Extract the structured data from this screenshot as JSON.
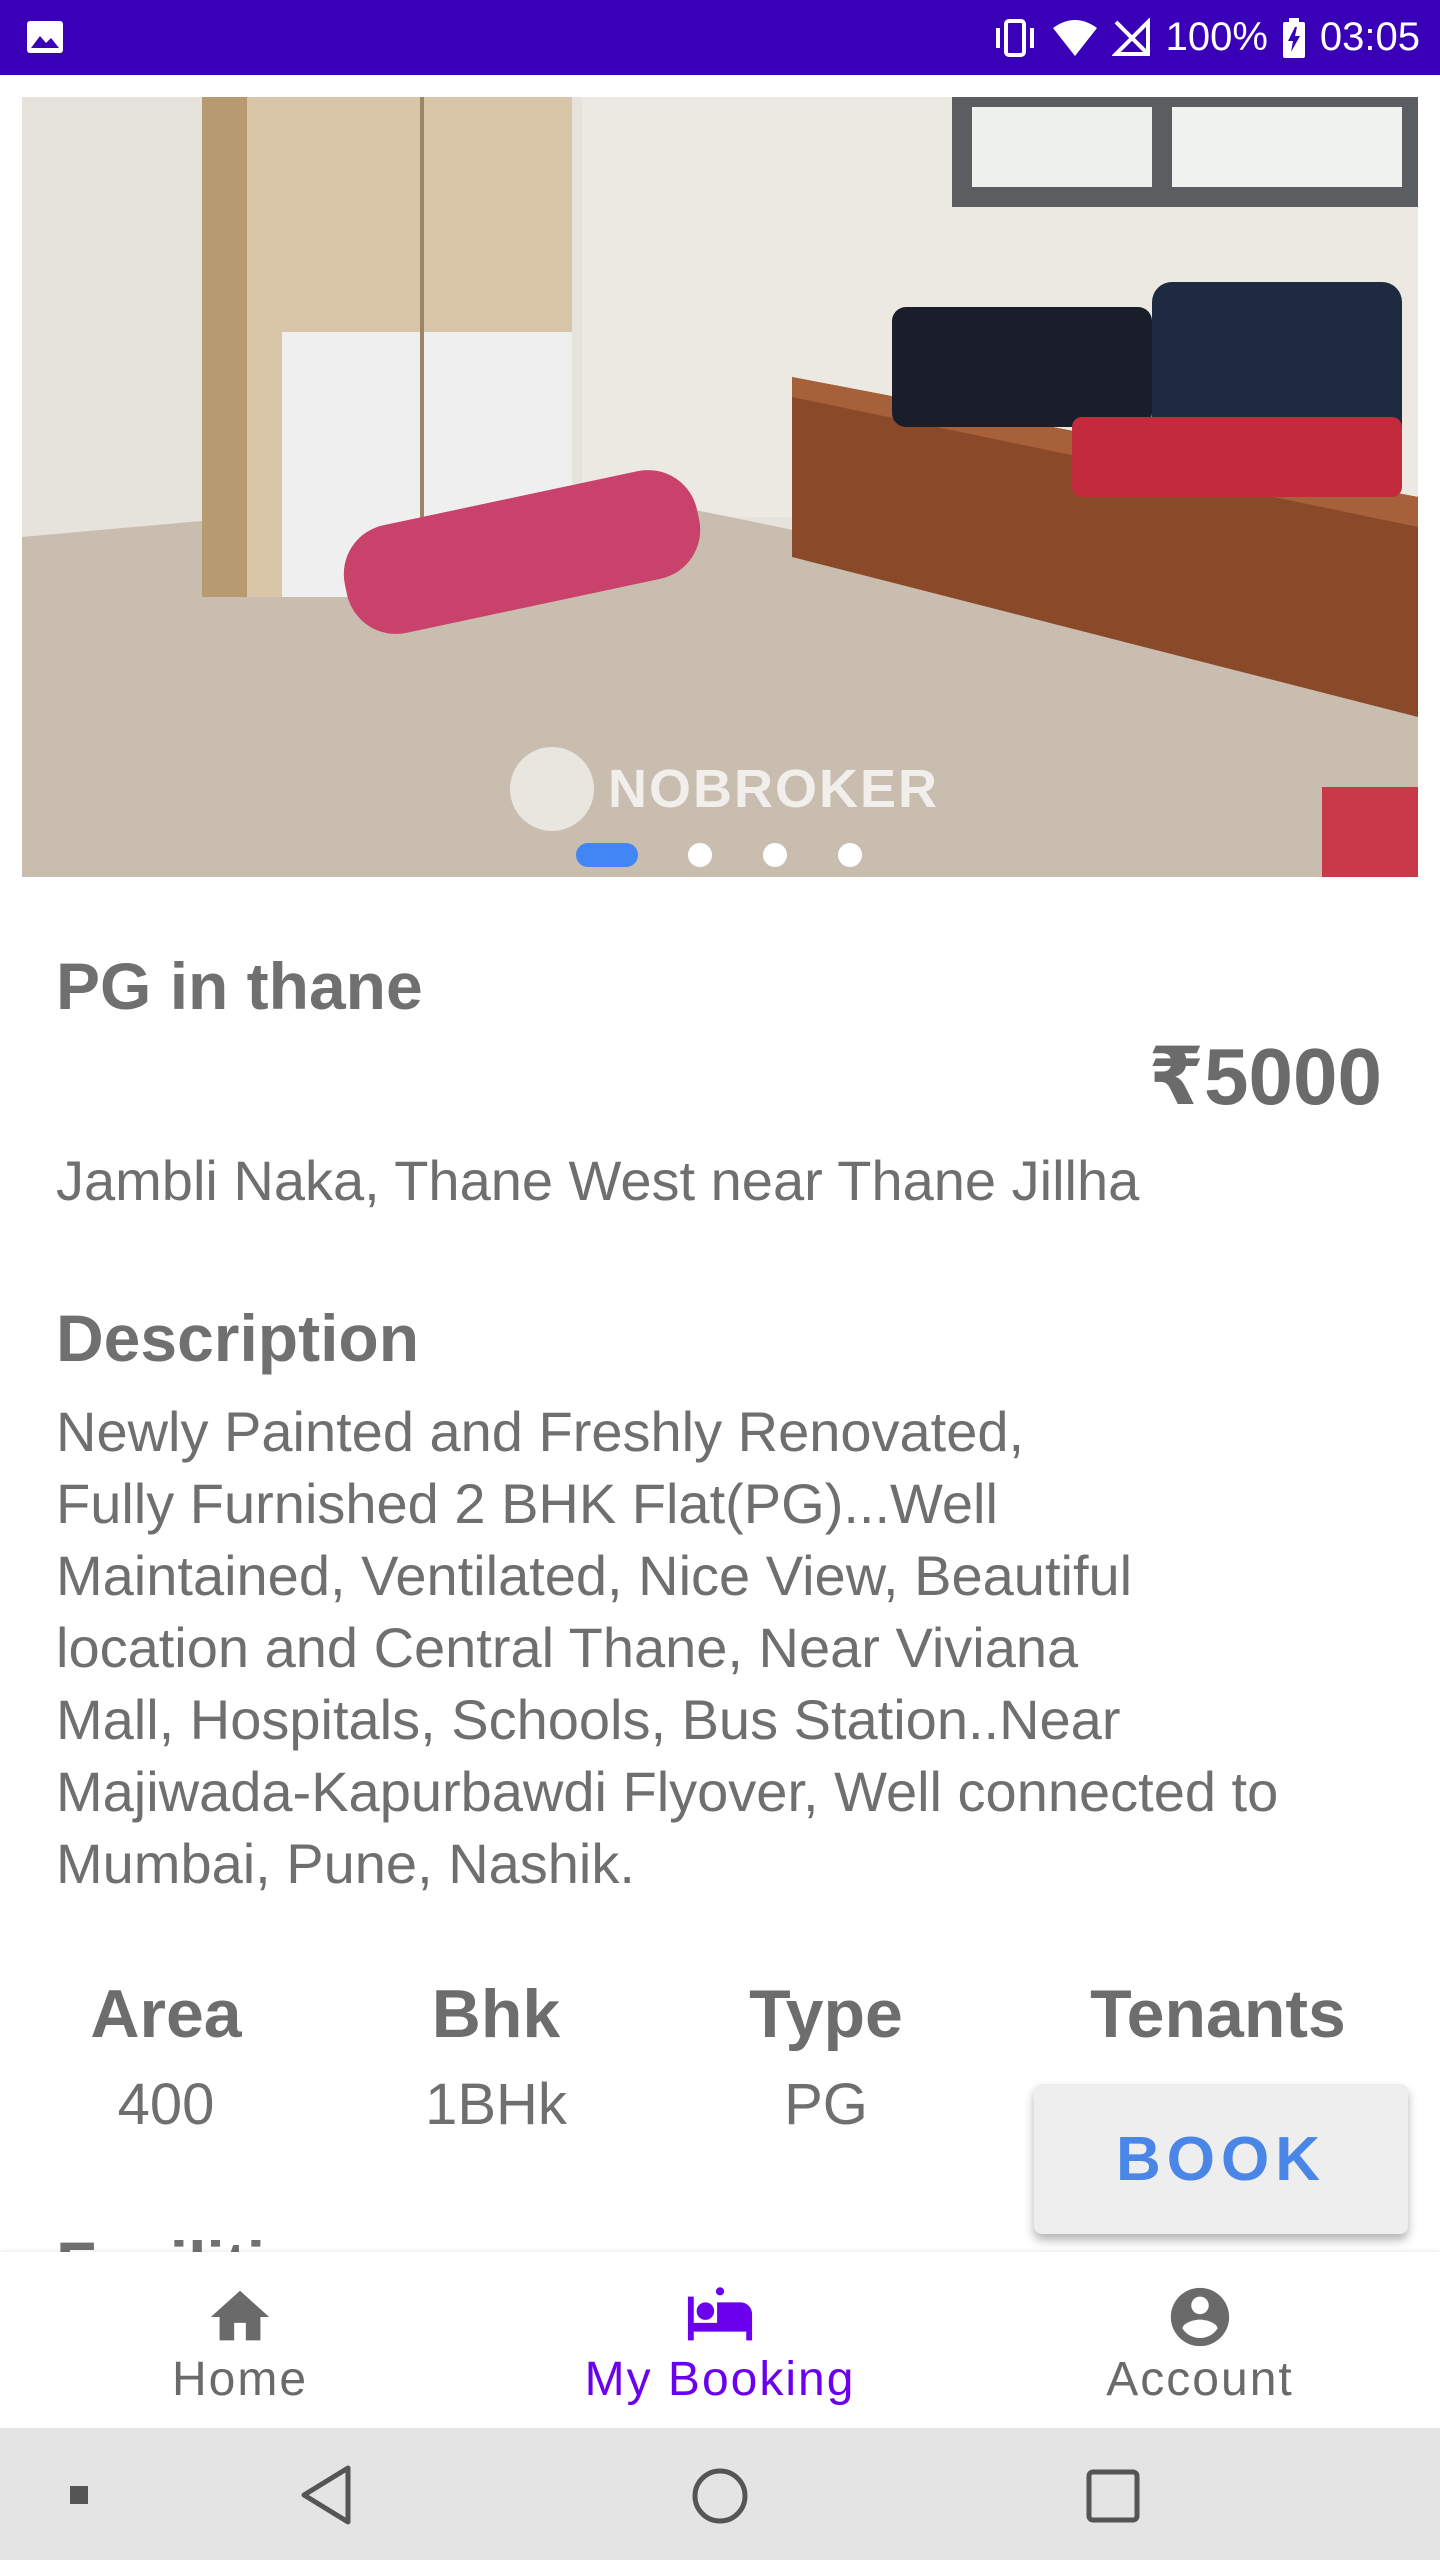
{
  "status_bar": {
    "battery_percent": "100%",
    "time": "03:05",
    "icons": [
      "gallery-icon",
      "vibrate-icon",
      "wifi-icon",
      "no-sim-icon",
      "battery-charging-icon"
    ]
  },
  "carousel": {
    "watermark": "NOBROKER",
    "page_count": 4,
    "active_index": 0
  },
  "listing": {
    "title": "PG in thane",
    "price": "₹5000",
    "address": "Jambli Naka, Thane West near Thane Jillha",
    "description_heading": "Description",
    "description_lines": [
      "Newly Painted and Freshly Renovated,",
      "Fully Furnished 2 BHK Flat(PG)...Well",
      "Maintained, Ventilated, Nice View, Beautiful",
      "location and Central Thane, Near Viviana",
      "Mall, Hospitals, Schools, Bus Station..Near",
      "Majiwada-Kapurbawdi Flyover, Well connected to",
      "Mumbai, Pune, Nashik."
    ],
    "stats": [
      {
        "label": "Area",
        "value": "400"
      },
      {
        "label": "Bhk",
        "value": "1BHk"
      },
      {
        "label": "Type",
        "value": "PG"
      },
      {
        "label": "Tenants",
        "value": ""
      }
    ],
    "facilities_heading": "Facilities"
  },
  "book_button": {
    "label": "BOOK"
  },
  "bottom_nav": {
    "items": [
      {
        "label": "Home",
        "icon": "home-icon",
        "active": false
      },
      {
        "label": "My Booking",
        "icon": "bed-icon",
        "active": true
      },
      {
        "label": "Account",
        "icon": "account-icon",
        "active": false
      }
    ],
    "active_color": "#6a00ee"
  },
  "colors": {
    "status_bar": "#3a00b8",
    "accent_blue": "#4a86e8"
  }
}
